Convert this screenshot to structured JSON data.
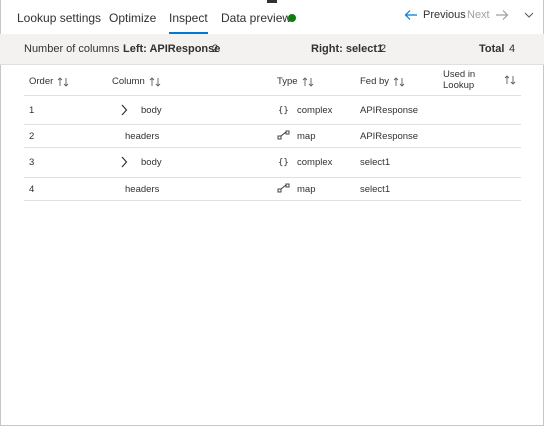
{
  "tabs": [
    {
      "label": "Lookup settings",
      "active": false
    },
    {
      "label": "Optimize",
      "active": false
    },
    {
      "label": "Inspect",
      "active": true
    },
    {
      "label": "Data preview",
      "active": false
    }
  ],
  "status_color": "#107c10",
  "nav": {
    "previous": "Previous",
    "next": "Next"
  },
  "summary": {
    "label": "Number of columns",
    "left_label": "Left: APIResponse",
    "left_count": "2",
    "right_label": "Right: select1",
    "right_count": "2",
    "total_label": "Total",
    "total_count": "4"
  },
  "table": {
    "headers": {
      "order": "Order",
      "column": "Column",
      "type": "Type",
      "fed_by": "Fed by",
      "used_in_lookup": "Used in Lookup"
    },
    "rows": [
      {
        "order": "1",
        "column": "body",
        "expandable": true,
        "type_icon": "braces-icon",
        "type": "complex",
        "fed_by": "APIResponse"
      },
      {
        "order": "2",
        "column": "headers",
        "expandable": false,
        "type_icon": "map-icon",
        "type": "map",
        "fed_by": "APIResponse"
      },
      {
        "order": "3",
        "column": "body",
        "expandable": true,
        "type_icon": "braces-icon",
        "type": "complex",
        "fed_by": "select1"
      },
      {
        "order": "4",
        "column": "headers",
        "expandable": false,
        "type_icon": "map-icon",
        "type": "map",
        "fed_by": "select1"
      }
    ]
  }
}
